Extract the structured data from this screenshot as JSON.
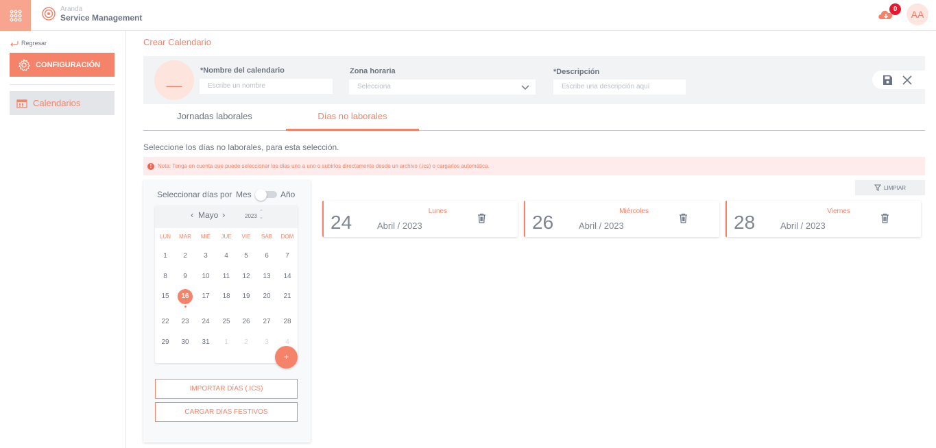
{
  "brand": {
    "small": "Aranda",
    "name": "Service Management"
  },
  "header": {
    "notifications": "0",
    "avatar": "AA"
  },
  "sidebar": {
    "back_label": "Regresar",
    "config_label": "CONFIGURACIÓN",
    "calendars_label": "Calendarios"
  },
  "page": {
    "title": "Crear Calendario"
  },
  "form": {
    "name_label": "*Nombre del calendario",
    "name_placeholder": "Escribe un nombre",
    "timezone_label": "Zona horaria",
    "timezone_placeholder": "Selecciona",
    "description_label": "*Descripción",
    "description_placeholder": "Escribe una descripción aquí",
    "avatar_placeholder": "__"
  },
  "tabs": [
    {
      "label": "Jornadas laborales"
    },
    {
      "label": "Días no laborales"
    }
  ],
  "instructions": "Seleccione los días no laborales, para esta selección.",
  "note": "Nota: Tenga en cuenta que puede seleccionar los días uno a uno o subirlos directamente desde un archivo (.ics) o cargarlos automática.",
  "calendar": {
    "select_by": "Seleccionar días por",
    "month_option": "Mes",
    "year_option": "Año",
    "month": "Mayo",
    "year": "2023",
    "weekdays": [
      "LUN",
      "MAR",
      "MIÉ",
      "JUE",
      "VIE",
      "SÁB",
      "DOM"
    ],
    "weeks": [
      [
        {
          "d": "1"
        },
        {
          "d": "2"
        },
        {
          "d": "3"
        },
        {
          "d": "4"
        },
        {
          "d": "5"
        },
        {
          "d": "6"
        },
        {
          "d": "7"
        }
      ],
      [
        {
          "d": "8"
        },
        {
          "d": "9"
        },
        {
          "d": "10"
        },
        {
          "d": "11"
        },
        {
          "d": "12"
        },
        {
          "d": "13"
        },
        {
          "d": "14"
        }
      ],
      [
        {
          "d": "15"
        },
        {
          "d": "16",
          "today": true
        },
        {
          "d": "17"
        },
        {
          "d": "18"
        },
        {
          "d": "19"
        },
        {
          "d": "20"
        },
        {
          "d": "21"
        }
      ],
      [
        {
          "d": "22"
        },
        {
          "d": "23"
        },
        {
          "d": "24"
        },
        {
          "d": "25"
        },
        {
          "d": "26"
        },
        {
          "d": "27"
        },
        {
          "d": "28"
        }
      ],
      [
        {
          "d": "29"
        },
        {
          "d": "30"
        },
        {
          "d": "31"
        },
        {
          "d": "1",
          "other": true
        },
        {
          "d": "2",
          "other": true
        },
        {
          "d": "3",
          "other": true
        },
        {
          "d": "4",
          "other": true
        }
      ]
    ],
    "add_label": "+",
    "import_label": "IMPORTAR DÍAS (.ICS)",
    "holidays_label": "CARGAR DÍAS FESTIVOS"
  },
  "clear_label": "LIMPIAR",
  "selected_days": [
    {
      "weekday": "Lunes",
      "day": "24",
      "month_year": "Abril / 2023"
    },
    {
      "weekday": "Miércoles",
      "day": "26",
      "month_year": "Abril / 2023"
    },
    {
      "weekday": "Viernes",
      "day": "28",
      "month_year": "Abril / 2023"
    }
  ],
  "colors": {
    "accent": "#f5836a",
    "accent_light": "#fde4dd",
    "badge": "#e8172c"
  }
}
